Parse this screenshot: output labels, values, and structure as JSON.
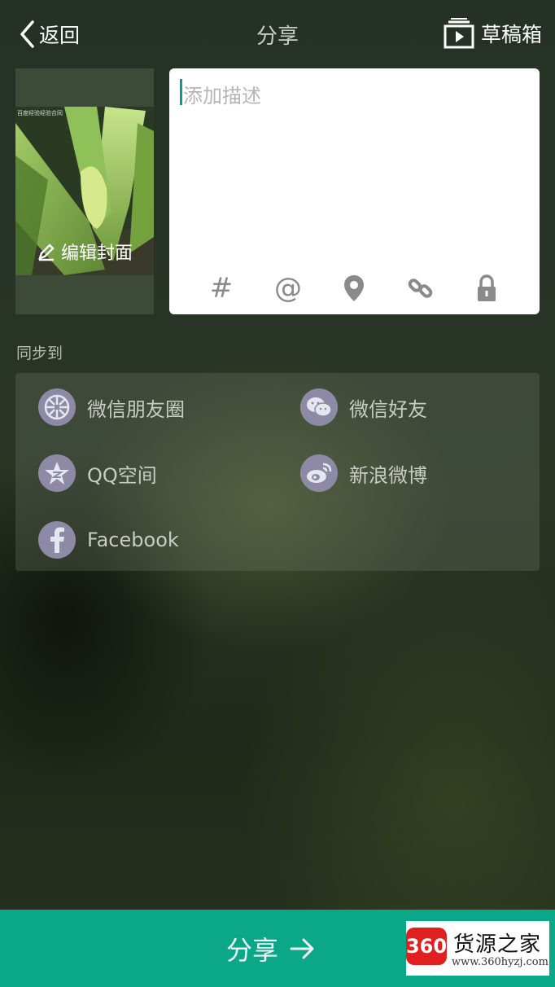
{
  "header": {
    "back_label": "返回",
    "title": "分享",
    "drafts_label": "草稿箱"
  },
  "cover": {
    "edit_label": "编辑封面",
    "watermark_text": "百度经验经验合同"
  },
  "description": {
    "placeholder": "添加描述",
    "tools": [
      {
        "icon": "hashtag-icon",
        "glyph": "#"
      },
      {
        "icon": "at-mention-icon",
        "glyph": "@"
      },
      {
        "icon": "location-pin-icon"
      },
      {
        "icon": "link-icon"
      },
      {
        "icon": "lock-icon"
      }
    ]
  },
  "sync": {
    "label": "同步到",
    "items": [
      {
        "label": "微信朋友圈",
        "icon": "wechat-moments-icon"
      },
      {
        "label": "微信好友",
        "icon": "wechat-icon"
      },
      {
        "label": "QQ空间",
        "icon": "qzone-icon"
      },
      {
        "label": "新浪微博",
        "icon": "weibo-icon"
      },
      {
        "label": "Facebook",
        "icon": "facebook-icon"
      }
    ]
  },
  "footer": {
    "share_label": "分享"
  },
  "watermark_logo": {
    "badge": "360",
    "name": "货源之家",
    "url": "www.360hyzj.com"
  },
  "colors": {
    "accent": "#0aa889",
    "icon_circle": "#8e8aa6"
  }
}
